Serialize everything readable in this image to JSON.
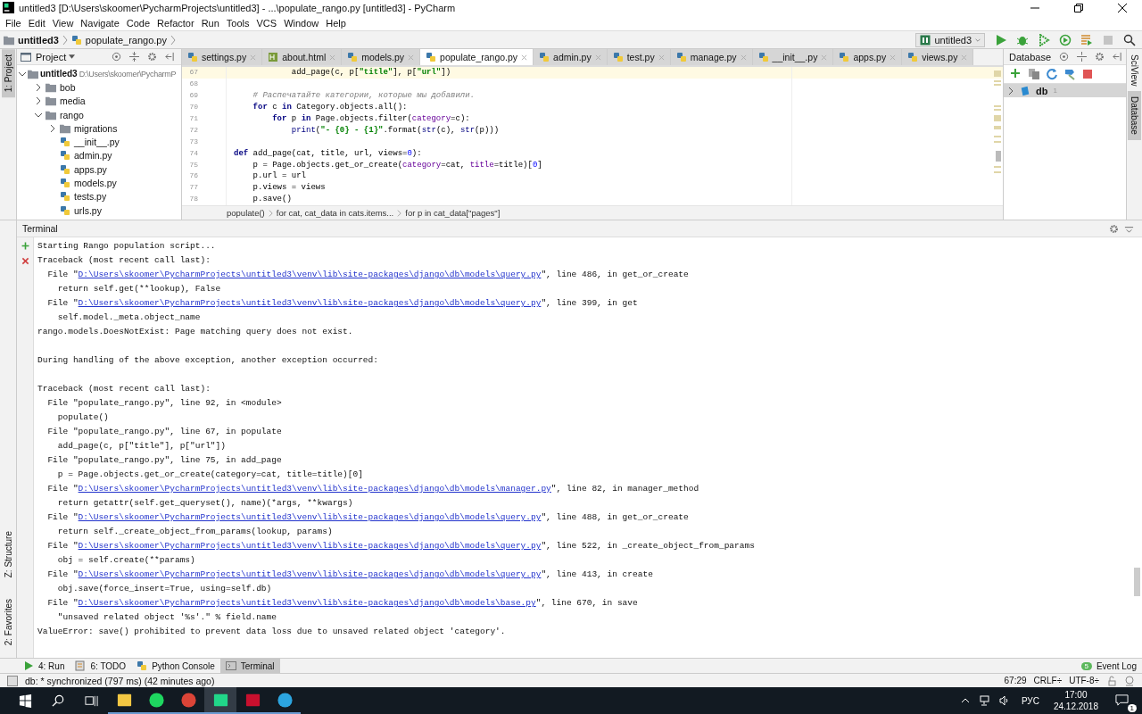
{
  "window": {
    "title": "untitled3 [D:\\Users\\skoomer\\PycharmProjects\\untitled3] - ...\\populate_rango.py [untitled3] - PyCharm"
  },
  "menu": [
    "File",
    "Edit",
    "View",
    "Navigate",
    "Code",
    "Refactor",
    "Run",
    "Tools",
    "VCS",
    "Window",
    "Help"
  ],
  "nav_bar": {
    "crumbs": [
      "untitled3",
      "populate_rango.py"
    ],
    "run_config": "untitled3"
  },
  "left_strip": [
    {
      "label": "1: Project",
      "selected": true
    }
  ],
  "left_strip_bottom": [
    {
      "label": "Z: Structure",
      "selected": false
    },
    {
      "label": "2: Favorites",
      "selected": false
    }
  ],
  "right_strip": [
    {
      "label": "SciView",
      "selected": false
    },
    {
      "label": "Database",
      "selected": true
    }
  ],
  "project": {
    "title": "Project",
    "tree": [
      {
        "name": "untitled3",
        "path": "D:\\Users\\skoomer\\PycharmP",
        "kind": "folder",
        "expanded": true,
        "children": [
          {
            "name": "bob",
            "kind": "folder",
            "expanded": false
          },
          {
            "name": "media",
            "kind": "folder",
            "expanded": false
          },
          {
            "name": "rango",
            "kind": "folder",
            "expanded": true,
            "children": [
              {
                "name": "migrations",
                "kind": "folder",
                "expanded": false
              },
              {
                "name": "__init__.py",
                "kind": "file"
              },
              {
                "name": "admin.py",
                "kind": "file"
              },
              {
                "name": "apps.py",
                "kind": "file"
              },
              {
                "name": "models.py",
                "kind": "file"
              },
              {
                "name": "tests.py",
                "kind": "file"
              },
              {
                "name": "urls.py",
                "kind": "file"
              }
            ]
          }
        ]
      }
    ]
  },
  "tabs": [
    {
      "label": "settings.py",
      "kind": "py",
      "selected": false
    },
    {
      "label": "about.html",
      "kind": "html",
      "selected": false
    },
    {
      "label": "models.py",
      "kind": "py",
      "selected": false
    },
    {
      "label": "populate_rango.py",
      "kind": "py",
      "selected": true
    },
    {
      "label": "admin.py",
      "kind": "py",
      "selected": false
    },
    {
      "label": "test.py",
      "kind": "py",
      "selected": false
    },
    {
      "label": "manage.py",
      "kind": "py",
      "selected": false
    },
    {
      "label": "__init__.py",
      "kind": "py",
      "selected": false
    },
    {
      "label": "apps.py",
      "kind": "py",
      "selected": false
    },
    {
      "label": "views.py",
      "kind": "py",
      "selected": false
    }
  ],
  "editor": {
    "lines": [
      {
        "number": "67",
        "current": true,
        "tokens": [
          {
            "kind": "plain",
            "t": "            add_page(c, p["
          },
          {
            "kind": "str",
            "t": "\"title\""
          },
          {
            "kind": "plain",
            "t": "], p["
          },
          {
            "kind": "str",
            "t": "\"url\""
          },
          {
            "kind": "plain",
            "t": "])"
          }
        ]
      },
      {
        "number": "68",
        "current": false
      },
      {
        "number": "69",
        "current": false,
        "tokens": [
          {
            "kind": "cm",
            "t": "    # Распечатайте категории, которые мы добавили."
          }
        ]
      },
      {
        "number": "70",
        "current": false,
        "tokens": [
          {
            "kind": "kw",
            "t": "    for"
          },
          {
            "kind": "plain",
            "t": " c "
          },
          {
            "kind": "kw",
            "t": "in"
          },
          {
            "kind": "plain",
            "t": " Category.objects.all():"
          }
        ]
      },
      {
        "number": "71",
        "current": false,
        "tokens": [
          {
            "kind": "kw",
            "t": "        for"
          },
          {
            "kind": "plain",
            "t": " p "
          },
          {
            "kind": "kw",
            "t": "in"
          },
          {
            "kind": "plain",
            "t": " Page.objects.filter("
          },
          {
            "kind": "arg",
            "t": "category"
          },
          {
            "kind": "plain",
            "t": "=c):"
          }
        ]
      },
      {
        "number": "72",
        "current": false,
        "tokens": [
          {
            "kind": "bi",
            "t": "            print"
          },
          {
            "kind": "plain",
            "t": "("
          },
          {
            "kind": "str",
            "t": "\"- {0} - {1}\""
          },
          {
            "kind": "plain",
            "t": ".format("
          },
          {
            "kind": "bi",
            "t": "str"
          },
          {
            "kind": "plain",
            "t": "(c), "
          },
          {
            "kind": "bi",
            "t": "str"
          },
          {
            "kind": "plain",
            "t": "(p)))"
          }
        ]
      },
      {
        "number": "73",
        "current": false
      },
      {
        "number": "74",
        "current": false,
        "tokens": [
          {
            "kind": "kw",
            "t": "def"
          },
          {
            "kind": "plain",
            "t": " add_page(cat, title, url, views="
          },
          {
            "kind": "num",
            "t": "0"
          },
          {
            "kind": "plain",
            "t": "):"
          }
        ]
      },
      {
        "number": "75",
        "current": false,
        "tokens": [
          {
            "kind": "plain",
            "t": "    p = Page.objects.get_or_create("
          },
          {
            "kind": "arg",
            "t": "category"
          },
          {
            "kind": "plain",
            "t": "=cat, "
          },
          {
            "kind": "arg",
            "t": "title"
          },
          {
            "kind": "plain",
            "t": "=title)["
          },
          {
            "kind": "num",
            "t": "0"
          },
          {
            "kind": "plain",
            "t": "]"
          }
        ]
      },
      {
        "number": "76",
        "current": false,
        "tokens": [
          {
            "kind": "plain",
            "t": "    p.url = url"
          }
        ]
      },
      {
        "number": "77",
        "current": false,
        "tokens": [
          {
            "kind": "plain",
            "t": "    p.views = views"
          }
        ]
      },
      {
        "number": "78",
        "current": false,
        "tokens": [
          {
            "kind": "plain",
            "t": "    p.save()"
          }
        ]
      }
    ],
    "breadcrumbs": [
      "populate()",
      "for cat, cat_data in cats.items...",
      "for p in cat_data[\"pages\"]"
    ]
  },
  "database": {
    "title": "Database",
    "items": [
      {
        "name": "db",
        "count": "1",
        "selected": true
      }
    ]
  },
  "terminal": {
    "title": "Terminal",
    "lines": [
      {
        "kind": "plain",
        "text": "Starting Rango population script..."
      },
      {
        "kind": "plain",
        "text": "Traceback (most recent call last):"
      },
      {
        "kind": "link",
        "pre": "  File \"",
        "link": "D:\\Users\\skoomer\\PycharmProjects\\untitled3\\venv\\lib\\site-packages\\django\\db\\models\\query.py",
        "post": "\", line 486, in get_or_create"
      },
      {
        "kind": "plain",
        "text": "    return self.get(**lookup), False"
      },
      {
        "kind": "link",
        "pre": "  File \"",
        "link": "D:\\Users\\skoomer\\PycharmProjects\\untitled3\\venv\\lib\\site-packages\\django\\db\\models\\query.py",
        "post": "\", line 399, in get"
      },
      {
        "kind": "plain",
        "text": "    self.model._meta.object_name"
      },
      {
        "kind": "plain",
        "text": "rango.models.DoesNotExist: Page matching query does not exist."
      },
      {
        "kind": "blank"
      },
      {
        "kind": "plain",
        "text": "During handling of the above exception, another exception occurred:"
      },
      {
        "kind": "blank"
      },
      {
        "kind": "plain",
        "text": "Traceback (most recent call last):"
      },
      {
        "kind": "plain",
        "text": "  File \"populate_rango.py\", line 92, in <module>"
      },
      {
        "kind": "plain",
        "text": "    populate()"
      },
      {
        "kind": "plain",
        "text": "  File \"populate_rango.py\", line 67, in populate"
      },
      {
        "kind": "plain",
        "text": "    add_page(c, p[\"title\"], p[\"url\"])"
      },
      {
        "kind": "plain",
        "text": "  File \"populate_rango.py\", line 75, in add_page"
      },
      {
        "kind": "plain",
        "text": "    p = Page.objects.get_or_create(category=cat, title=title)[0]"
      },
      {
        "kind": "link",
        "pre": "  File \"",
        "link": "D:\\Users\\skoomer\\PycharmProjects\\untitled3\\venv\\lib\\site-packages\\django\\db\\models\\manager.py",
        "post": "\", line 82, in manager_method"
      },
      {
        "kind": "plain",
        "text": "    return getattr(self.get_queryset(), name)(*args, **kwargs)"
      },
      {
        "kind": "link",
        "pre": "  File \"",
        "link": "D:\\Users\\skoomer\\PycharmProjects\\untitled3\\venv\\lib\\site-packages\\django\\db\\models\\query.py",
        "post": "\", line 488, in get_or_create"
      },
      {
        "kind": "plain",
        "text": "    return self._create_object_from_params(lookup, params)"
      },
      {
        "kind": "link",
        "pre": "  File \"",
        "link": "D:\\Users\\skoomer\\PycharmProjects\\untitled3\\venv\\lib\\site-packages\\django\\db\\models\\query.py",
        "post": "\", line 522, in _create_object_from_params"
      },
      {
        "kind": "plain",
        "text": "    obj = self.create(**params)"
      },
      {
        "kind": "link",
        "pre": "  File \"",
        "link": "D:\\Users\\skoomer\\PycharmProjects\\untitled3\\venv\\lib\\site-packages\\django\\db\\models\\query.py",
        "post": "\", line 413, in create"
      },
      {
        "kind": "plain",
        "text": "    obj.save(force_insert=True, using=self.db)"
      },
      {
        "kind": "link",
        "pre": "  File \"",
        "link": "D:\\Users\\skoomer\\PycharmProjects\\untitled3\\venv\\lib\\site-packages\\django\\db\\models\\base.py",
        "post": "\", line 670, in save"
      },
      {
        "kind": "plain",
        "text": "    \"unsaved related object '%s'.\" % field.name"
      },
      {
        "kind": "plain",
        "text": "ValueError: save() prohibited to prevent data loss due to unsaved related object 'category'."
      }
    ]
  },
  "tool_windows": [
    {
      "label": "4: Run",
      "kind": "run",
      "selected": false
    },
    {
      "label": "6: TODO",
      "kind": "todo",
      "selected": false
    },
    {
      "label": "Python Console",
      "kind": "console",
      "selected": false
    },
    {
      "label": "Terminal",
      "kind": "terminal",
      "selected": true
    }
  ],
  "event_log": {
    "label": "Event Log",
    "count": "5"
  },
  "status_bar": {
    "message": "db: * synchronized (797 ms) (42 minutes ago)",
    "position": "67:29",
    "line_sep": "CRLF÷",
    "encoding": "UTF-8÷"
  },
  "taskbar": {
    "apps": [
      {
        "kind": "explorer",
        "selected": false
      },
      {
        "kind": "spotify",
        "selected": false
      },
      {
        "kind": "chrome",
        "selected": false
      },
      {
        "kind": "pycharm",
        "selected": true
      },
      {
        "kind": "pdf",
        "selected": false
      },
      {
        "kind": "telegram",
        "selected": false
      }
    ],
    "language": "РУС",
    "time": "17:00",
    "date": "24.12.2018",
    "notifications": "1"
  }
}
